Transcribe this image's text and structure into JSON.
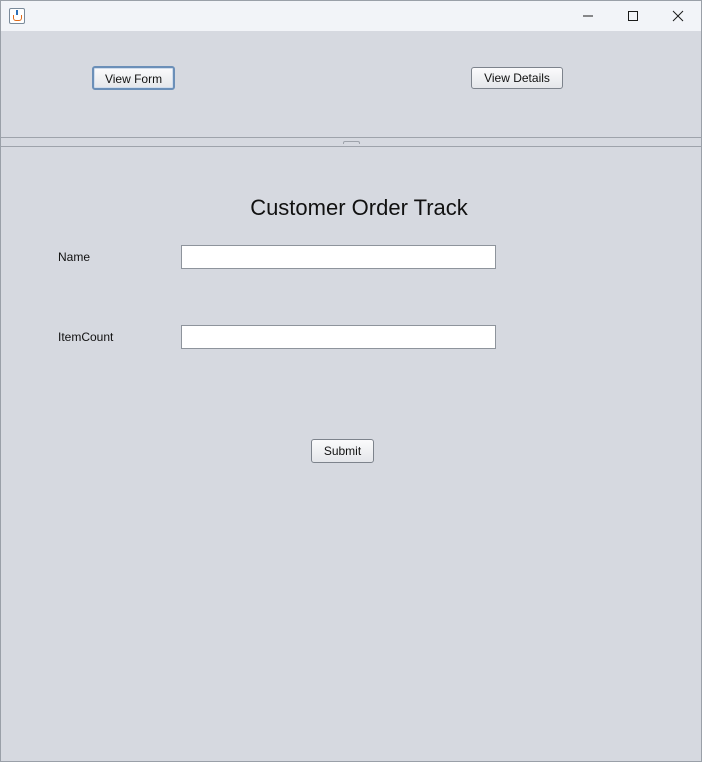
{
  "window": {
    "title": "",
    "controls": {
      "minimize_icon": "minimize-icon",
      "maximize_icon": "maximize-icon",
      "close_icon": "close-icon"
    }
  },
  "nav": {
    "view_form_label": "View Form",
    "view_details_label": "View Details"
  },
  "form": {
    "title": "Customer Order Track",
    "fields": [
      {
        "label": "Name",
        "value": ""
      },
      {
        "label": "ItemCount",
        "value": ""
      }
    ],
    "submit_label": "Submit"
  },
  "colors": {
    "background": "#d6d9e0",
    "titlebar": "#f2f4f8",
    "focus_border": "#6b8fb8"
  }
}
